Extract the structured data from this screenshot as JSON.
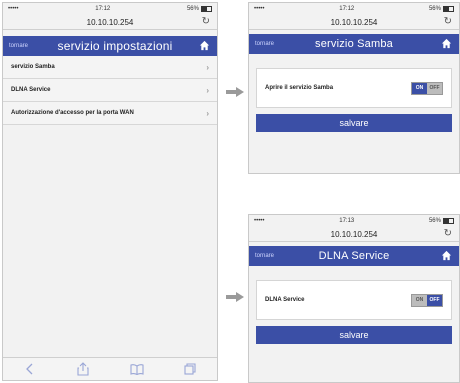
{
  "status": {
    "signal": "•••••",
    "time1": "17:12",
    "time2": "17:13",
    "battery": "56%"
  },
  "url": "10.10.10.254",
  "back_label": "tornare",
  "screen1": {
    "title": "servizio impostazioni",
    "items": [
      {
        "label": "servizio Samba"
      },
      {
        "label": "DLNA Service"
      },
      {
        "label": "Autorizzazione d'accesso per la porta WAN"
      }
    ]
  },
  "screen2": {
    "title": "servizio Samba",
    "setting_label": "Aprire il servizio Samba",
    "toggle_on": "ON",
    "toggle_off": "OFF",
    "save": "salvare"
  },
  "screen3": {
    "title": "DLNA Service",
    "setting_label": "DLNA Service",
    "toggle_on": "ON",
    "toggle_off": "OFF",
    "save": "salvare"
  },
  "colors": {
    "accent": "#3b4fa6",
    "arrow": "#9a9a9a"
  }
}
